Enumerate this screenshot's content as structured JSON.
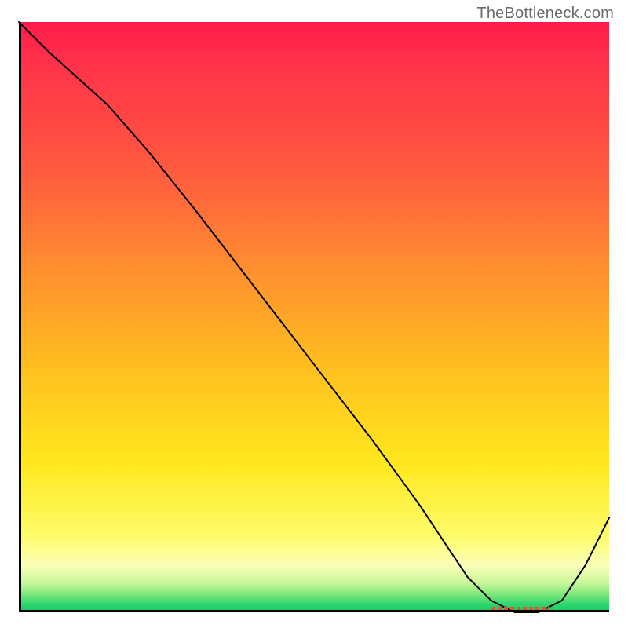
{
  "watermark": "TheBottleneck.com",
  "colors": {
    "grad_top": "#ff1b4a",
    "grad_bottom": "#12c95f",
    "curve": "#000000",
    "trough_mark": "#e4503a"
  },
  "chart_data": {
    "type": "line",
    "title": "",
    "xlabel": "",
    "ylabel": "",
    "xlim": [
      0,
      100
    ],
    "ylim": [
      0,
      100
    ],
    "grid": false,
    "legend": false,
    "series": [
      {
        "name": "bottleneck-curve",
        "x": [
          0,
          5,
          15,
          22,
          30,
          40,
          50,
          60,
          68,
          72,
          76,
          80,
          84,
          88,
          92,
          96,
          100
        ],
        "y": [
          100,
          95,
          86,
          78,
          68,
          55,
          42,
          29,
          18,
          12,
          6,
          2,
          0,
          0,
          2,
          8,
          16
        ]
      }
    ],
    "annotations": [
      {
        "name": "trough-marker",
        "x_start": 80,
        "x_end": 90,
        "y": 0
      }
    ]
  }
}
